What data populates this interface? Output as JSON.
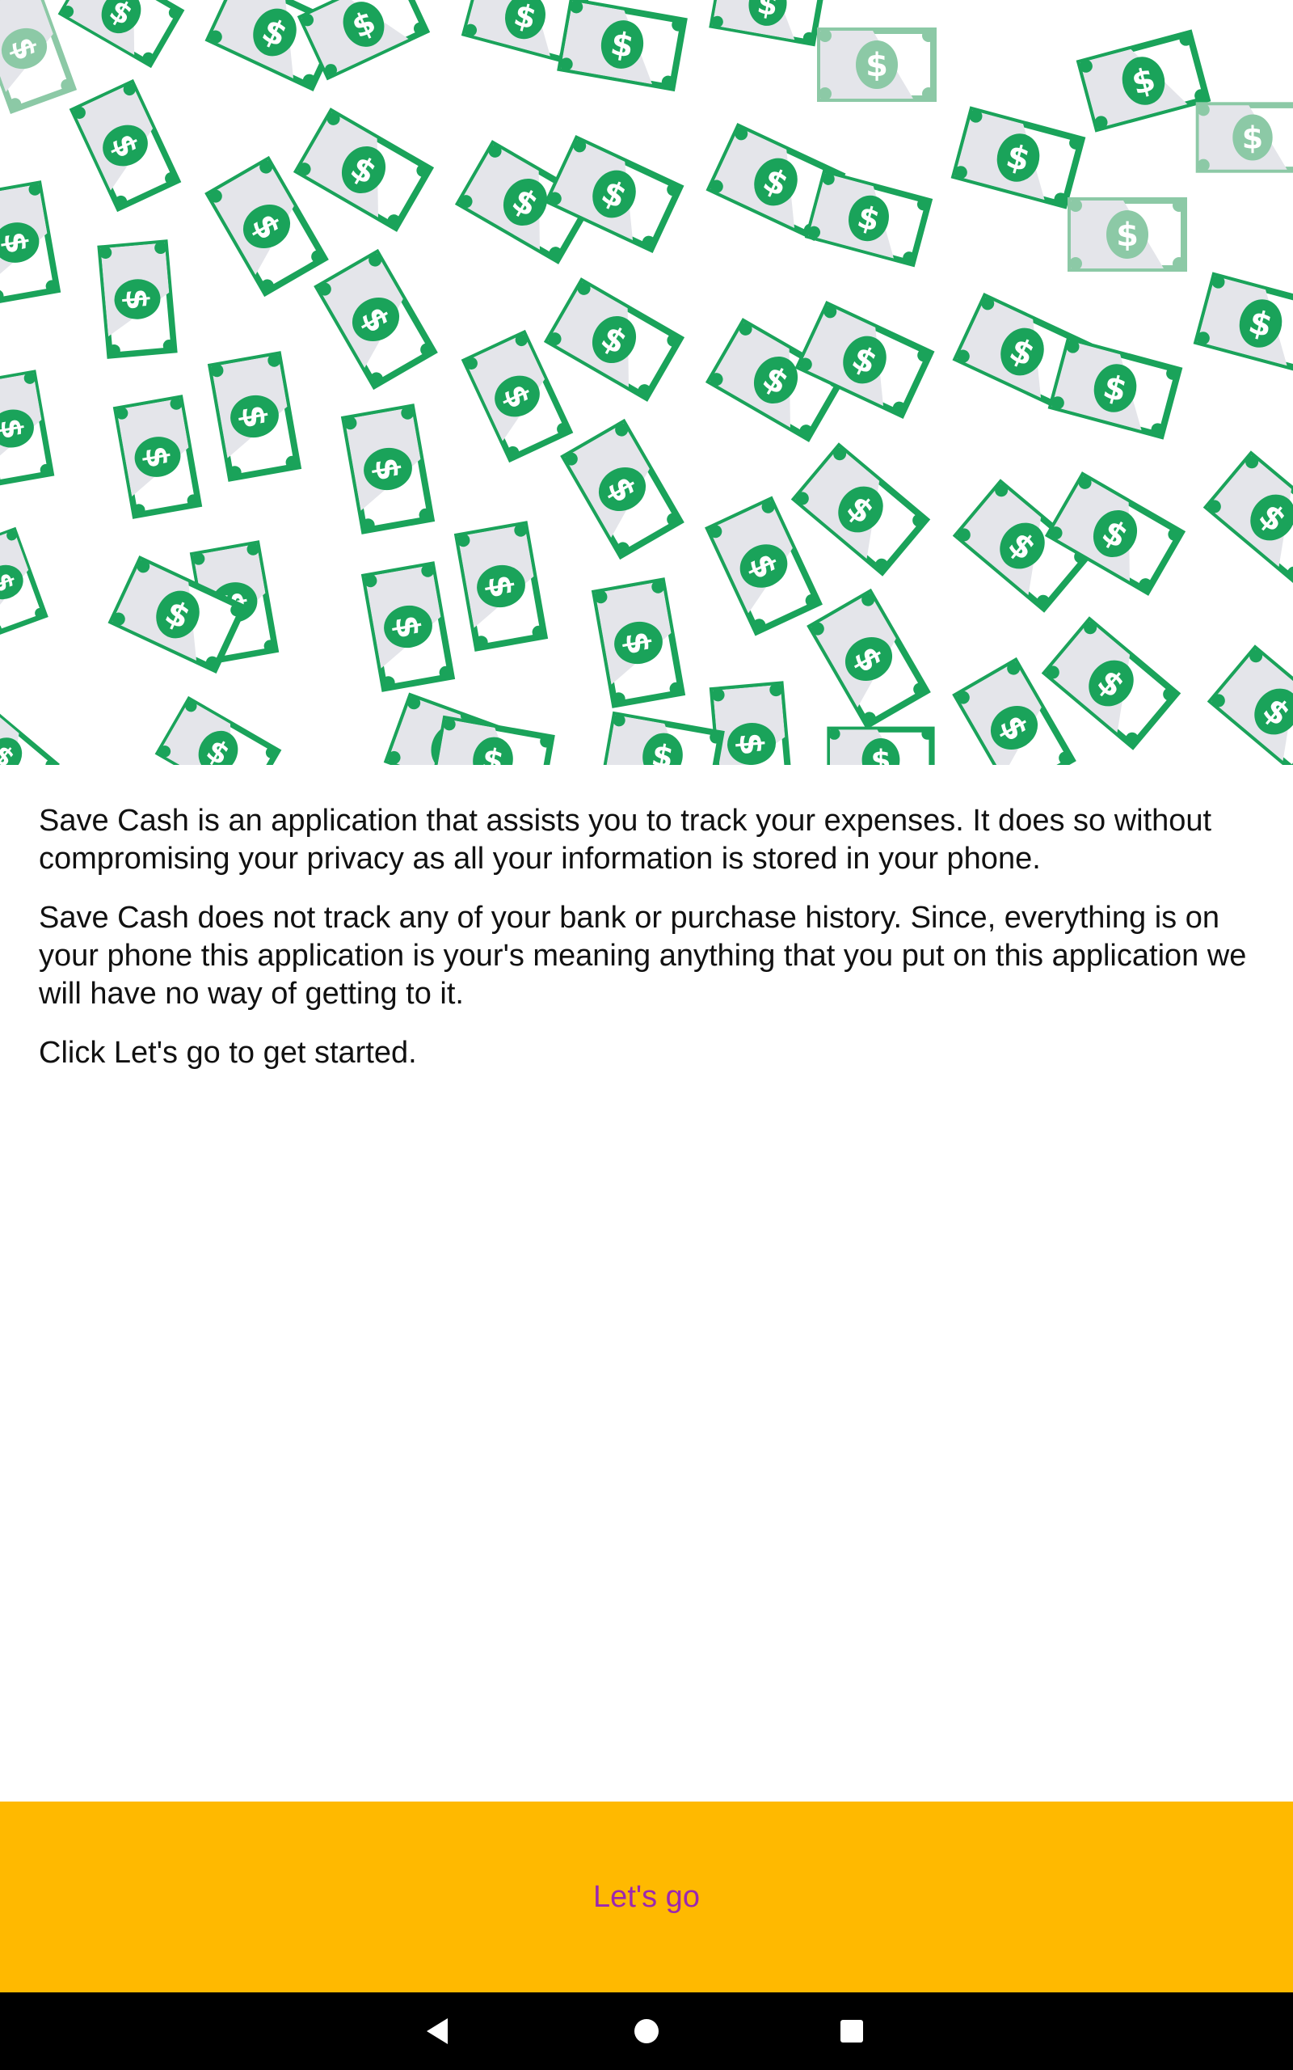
{
  "hero": {
    "illustration": "falling-dollar-bills",
    "colors": {
      "bill_dark": "#1AA35A",
      "bill_light": "#8CC9A6",
      "bill_fill": "#FFFFFF",
      "bill_shade": "#E4E5EA"
    }
  },
  "intro": {
    "paragraph_1": "Save Cash is an application that assists you to track your expenses. It does so without compromising your privacy as all your information is stored in your phone.",
    "paragraph_2": "Save Cash does not track any of your bank or purchase history. Since, everything is on your phone this application is your's meaning anything that you put on this application we will have no way of getting to it.",
    "paragraph_3": "Click Let's go to get started."
  },
  "cta": {
    "label": "Let's go",
    "background": "#FFB900",
    "text_color": "#9C27B0"
  },
  "navbar": {
    "back_icon": "triangle-back-icon",
    "home_icon": "circle-home-icon",
    "recents_icon": "square-recents-icon"
  }
}
